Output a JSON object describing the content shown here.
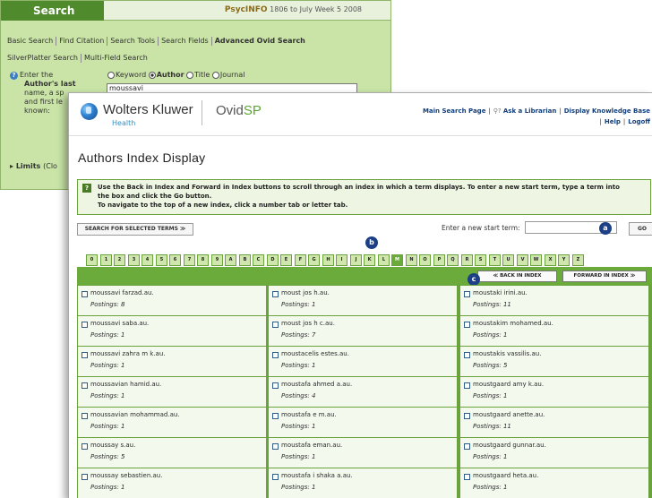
{
  "background_window": {
    "title": "Search",
    "db_name": "PsycINFO",
    "db_range": "1806 to July Week 5 2008",
    "tabs_row1": [
      "Basic Search",
      "Find Citation",
      "Search Tools",
      "Search Fields",
      "Advanced Ovid Search"
    ],
    "tabs_row2": [
      "SilverPlatter Search",
      "Multi-Field Search"
    ],
    "help_icon": "?",
    "enter_lines": [
      "Enter the",
      "Author's last",
      "name, a sp",
      "and first le",
      "known:"
    ],
    "radio_options": [
      "Keyword",
      "Author",
      "Title",
      "Journal"
    ],
    "author_value": "moussavi",
    "limits_label": "Limits",
    "limits_tail": "(Clo"
  },
  "header": {
    "logo_name": "Wolters Kluwer",
    "logo_sub": "Health",
    "product": "Ovid",
    "product_sp": "SP",
    "links": [
      "Main Search Page",
      "Ask a Librarian",
      "Display Knowledge Base",
      "Help",
      "Logoff"
    ],
    "ask_icon": "person-help-icon"
  },
  "page": {
    "title": "Authors Index Display",
    "info_icon": "?",
    "info_lines": [
      "Use the Back in Index and Forward in Index buttons to scroll through an index in which a term displays. To enter a new start term, type a term into",
      "the box and click the Go button.",
      "To navigate to the top of a new index, click a number tab or letter tab."
    ],
    "search_selected": "SEARCH FOR SELECTED TERMS ≫",
    "start_label": "Enter a new start term:",
    "go": "GO",
    "callouts": [
      "a",
      "b",
      "c"
    ],
    "tabs": [
      "0",
      "1",
      "2",
      "3",
      "4",
      "5",
      "6",
      "7",
      "8",
      "9",
      "A",
      "B",
      "C",
      "D",
      "E",
      "F",
      "G",
      "H",
      "I",
      "J",
      "K",
      "L",
      "M",
      "N",
      "O",
      "P",
      "Q",
      "R",
      "S",
      "T",
      "U",
      "V",
      "W",
      "X",
      "Y",
      "Z"
    ],
    "active_tab": "M",
    "back_btn": "≪ BACK IN INDEX",
    "fwd_btn": "FORWARD IN INDEX ≫",
    "postings_label": "Postings:"
  },
  "entries": [
    {
      "term": "moussavi farzad.au.",
      "postings": "8"
    },
    {
      "term": "moust jos h.au.",
      "postings": "1"
    },
    {
      "term": "moustaki irini.au.",
      "postings": "11"
    },
    {
      "term": "moussavi saba.au.",
      "postings": "1"
    },
    {
      "term": "moust jos h c.au.",
      "postings": "7"
    },
    {
      "term": "moustakim mohamed.au.",
      "postings": "1"
    },
    {
      "term": "moussavi zahra m k.au.",
      "postings": "1"
    },
    {
      "term": "moustacelis estes.au.",
      "postings": "1"
    },
    {
      "term": "moustakis vassilis.au.",
      "postings": "5"
    },
    {
      "term": "moussavian hamid.au.",
      "postings": "1"
    },
    {
      "term": "moustafa ahmed a.au.",
      "postings": "4"
    },
    {
      "term": "moustgaard amy k.au.",
      "postings": "1"
    },
    {
      "term": "moussavian mohammad.au.",
      "postings": "1"
    },
    {
      "term": "moustafa e m.au.",
      "postings": "1"
    },
    {
      "term": "moustgaard anette.au.",
      "postings": "11"
    },
    {
      "term": "moussay s.au.",
      "postings": "5"
    },
    {
      "term": "moustafa eman.au.",
      "postings": "1"
    },
    {
      "term": "moustgaard gunnar.au.",
      "postings": "1"
    },
    {
      "term": "moussay sebastien.au.",
      "postings": "1"
    },
    {
      "term": "moustafa i shaka a.au.",
      "postings": "1"
    },
    {
      "term": "moustgaard heta.au.",
      "postings": "1"
    }
  ]
}
